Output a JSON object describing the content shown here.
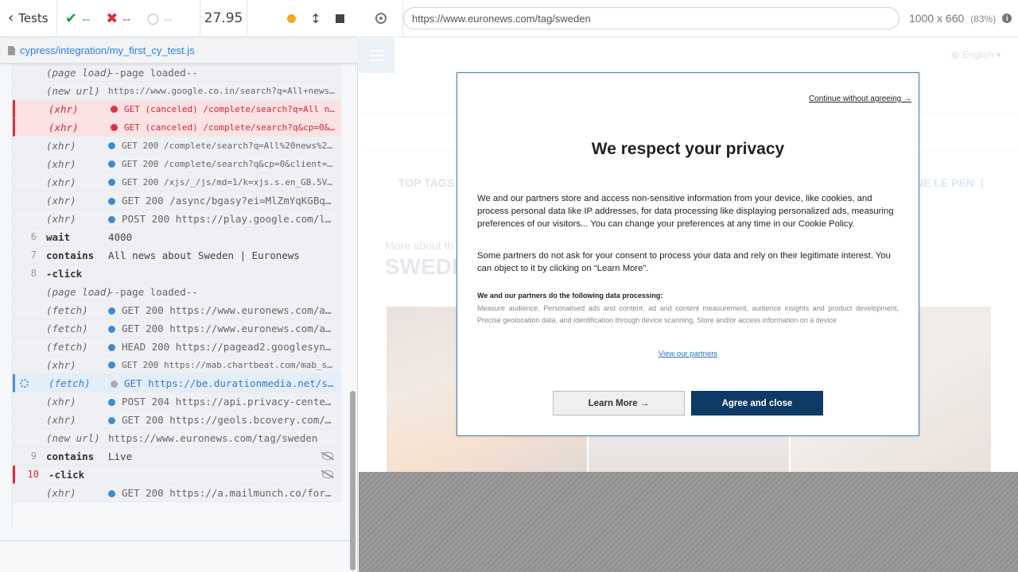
{
  "header": {
    "tests_label": "Tests",
    "passed": "--",
    "failed": "--",
    "pending": "--",
    "duration": "27.95"
  },
  "spec": {
    "path": "cypress/integration/my_first_cy_test.js"
  },
  "commands": [
    {
      "type": "log",
      "name": "(page load)",
      "message": "--page loaded--"
    },
    {
      "type": "log",
      "name": "(new url)",
      "message": "https://www.google.co.in/search?q=All+news+abo…",
      "small": true
    },
    {
      "type": "fail",
      "name": "(xhr)",
      "message": "GET (canceled) /complete/search?q=All news…",
      "bullet": "red",
      "small": true
    },
    {
      "type": "fail",
      "name": "(xhr)",
      "message": "GET (canceled) /complete/search?q&cp=0&cli…",
      "bullet": "red",
      "small": true
    },
    {
      "type": "log",
      "name": "(xhr)",
      "message": "GET 200 /complete/search?q=All%20news%20ab…",
      "bullet": "blue",
      "small": true
    },
    {
      "type": "log",
      "name": "(xhr)",
      "message": "GET 200 /complete/search?q&cp=0&client=gws…",
      "bullet": "blue",
      "small": true
    },
    {
      "type": "log",
      "name": "(xhr)",
      "message": "GET 200 /xjs/_/js/md=1/k=xjs.s.en_GB.5Vk2O…",
      "bullet": "blue",
      "small": true
    },
    {
      "type": "log",
      "name": "(xhr)",
      "message": "GET 200 /async/bgasy?ei=MlZmYqKGBqCM…",
      "bullet": "blue"
    },
    {
      "type": "log",
      "name": "(xhr)",
      "message": "POST 200 https://play.google.com/log…",
      "bullet": "blue"
    },
    {
      "type": "cmd",
      "num": "6",
      "name": "wait",
      "message": "4000"
    },
    {
      "type": "cmd",
      "num": "7",
      "name": "contains",
      "message": "All news about Sweden | Euronews"
    },
    {
      "type": "cmd",
      "num": "8",
      "name": "-click",
      "message": ""
    },
    {
      "type": "log",
      "name": "(page load)",
      "message": "--page loaded--"
    },
    {
      "type": "log",
      "name": "(fetch)",
      "message": "GET 200 https://www.euronews.com/api…",
      "bullet": "blue"
    },
    {
      "type": "log",
      "name": "(fetch)",
      "message": "GET 200 https://www.euronews.com/api…",
      "bullet": "blue"
    },
    {
      "type": "log",
      "name": "(fetch)",
      "message": "HEAD 200 https://pagead2.googlesyndi…",
      "bullet": "blue"
    },
    {
      "type": "log",
      "name": "(xhr)",
      "message": "GET 200 https://mab.chartbeat.com/mab_stra…",
      "bullet": "blue",
      "small": true
    },
    {
      "type": "active",
      "name": "(fetch)",
      "message": "GET https://be.durationmedia.net/scr…",
      "bullet": "gray"
    },
    {
      "type": "log",
      "name": "(xhr)",
      "message": "POST 204 https://api.privacy-center.…",
      "bullet": "blue"
    },
    {
      "type": "log",
      "name": "(xhr)",
      "message": "GET 200 https://geols.bcovery.com/ips",
      "bullet": "blue"
    },
    {
      "type": "log",
      "name": "(new url)",
      "message": "https://www.euronews.com/tag/sweden"
    },
    {
      "type": "cmd",
      "num": "9",
      "name": "contains",
      "message": "Live",
      "hidden": true
    },
    {
      "type": "failcmd",
      "num": "10",
      "name": "-click",
      "message": "",
      "hidden": true
    },
    {
      "type": "log",
      "name": "(xhr)",
      "message": "GET 200 https://a.mailmunch.co/forms…",
      "bullet": "blue"
    }
  ],
  "aut": {
    "url": "https://www.euronews.com/tag/sweden",
    "viewport": "1000 x 660",
    "zoom": "(83%)"
  },
  "site": {
    "language": "English",
    "top_tags": "TOP TAGS",
    "tag_partial": "NE LE PEN",
    "more_about": "More about th",
    "title_partial": "SWEDE"
  },
  "consent": {
    "continue_link": "Continue without agreeing →",
    "title": "We respect your privacy",
    "p1": "We and our partners store and access non-sensitive information from your device, like cookies, and process personal data like IP addresses, for data processing like displaying personalized ads, measuring preferences of our visitors... You can change your preferences at any time in our Cookie Policy.",
    "p2": "Some partners do not ask for your consent to process your data and rely on their legitimate interest. You can object to it by clicking on “Learn More”.",
    "processing_heading": "We and our partners do the following data processing:",
    "processing_list": "Measure audience, Personalised ads and content, ad and content measurement, audience insights and product development, Precise geolocation data, and identification through device scanning, Store and/or access information on a device",
    "partners_link": "View our partners",
    "learn_more": "Learn More →",
    "agree": "Agree and close"
  }
}
